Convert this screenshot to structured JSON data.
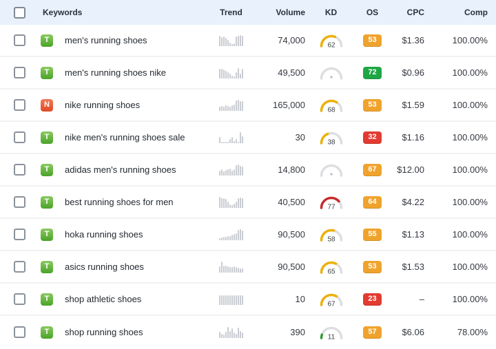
{
  "header": {
    "keywords": "Keywords",
    "trend": "Trend",
    "volume": "Volume",
    "kd": "KD",
    "os": "OS",
    "cpc": "CPC",
    "comp": "Comp"
  },
  "colors": {
    "header_bg": "#e9f1fc",
    "gauge_track": "#dcdee1",
    "gauge_na_dot": "#b6bac0",
    "spark_bar": "#c9ccd2",
    "kd": {
      "green": "#2f9e33",
      "yellow": "#edb009",
      "red": "#c62b2b",
      "gray": "#dcdee1"
    },
    "os": {
      "green": "#1ea744",
      "amber": "#f0a32c",
      "red": "#e23b31"
    },
    "intent": {
      "green": [
        "#8bc961",
        "#4aa328"
      ],
      "red": [
        "#f07a55",
        "#df4a26"
      ]
    }
  },
  "rows": [
    {
      "intent": "T",
      "intent_style": "green",
      "keyword": "men's running shoes",
      "volume": "74,000",
      "kd": 62,
      "kd_style": "yellow",
      "os": 53,
      "os_style": "amber",
      "cpc": "$1.36",
      "comp": "100.00%",
      "trend": [
        0.95,
        0.8,
        0.85,
        0.75,
        0.55,
        0.3,
        0.2,
        0.25,
        0.9,
        0.95,
        1.0,
        0.95
      ]
    },
    {
      "intent": "T",
      "intent_style": "green",
      "keyword": "men's running shoes nike",
      "volume": "49,500",
      "kd": null,
      "kd_style": "gray",
      "os": 72,
      "os_style": "green",
      "cpc": "$0.96",
      "comp": "100.00%",
      "trend": [
        0.9,
        0.85,
        0.8,
        0.7,
        0.55,
        0.45,
        0.25,
        0.2,
        0.55,
        0.95,
        0.45,
        0.85
      ]
    },
    {
      "intent": "N",
      "intent_style": "red",
      "keyword": "nike running shoes",
      "volume": "165,000",
      "kd": 68,
      "kd_style": "yellow",
      "os": 53,
      "os_style": "amber",
      "cpc": "$1.59",
      "comp": "100.00%",
      "trend": [
        0.35,
        0.45,
        0.4,
        0.5,
        0.45,
        0.4,
        0.5,
        0.55,
        0.95,
        1.0,
        0.9,
        0.85
      ]
    },
    {
      "intent": "T",
      "intent_style": "green",
      "keyword": "nike men's running shoes sale",
      "volume": "30",
      "kd": 38,
      "kd_style": "yellow",
      "os": 32,
      "os_style": "red",
      "cpc": "$1.16",
      "comp": "100.00%",
      "trend": [
        0.55,
        0.15,
        0.1,
        0.12,
        0.1,
        0.35,
        0.55,
        0.2,
        0.35,
        0.15,
        1.0,
        0.6
      ]
    },
    {
      "intent": "T",
      "intent_style": "green",
      "keyword": "adidas men's running shoes",
      "volume": "14,800",
      "kd": null,
      "kd_style": "gray",
      "os": 67,
      "os_style": "amber",
      "cpc": "$12.00",
      "comp": "100.00%",
      "trend": [
        0.45,
        0.55,
        0.35,
        0.5,
        0.55,
        0.65,
        0.45,
        0.55,
        0.95,
        1.0,
        0.9,
        0.8
      ]
    },
    {
      "intent": "T",
      "intent_style": "green",
      "keyword": "best running shoes for men",
      "volume": "40,500",
      "kd": 77,
      "kd_style": "red",
      "os": 64,
      "os_style": "amber",
      "cpc": "$4.22",
      "comp": "100.00%",
      "trend": [
        1.0,
        0.9,
        0.85,
        0.8,
        0.55,
        0.3,
        0.25,
        0.35,
        0.55,
        0.85,
        0.95,
        0.9
      ]
    },
    {
      "intent": "T",
      "intent_style": "green",
      "keyword": "hoka running shoes",
      "volume": "90,500",
      "kd": 58,
      "kd_style": "yellow",
      "os": 55,
      "os_style": "amber",
      "cpc": "$1.13",
      "comp": "100.00%",
      "trend": [
        0.2,
        0.25,
        0.3,
        0.3,
        0.35,
        0.4,
        0.5,
        0.55,
        0.65,
        0.95,
        1.0,
        0.9
      ]
    },
    {
      "intent": "T",
      "intent_style": "green",
      "keyword": "asics running shoes",
      "volume": "90,500",
      "kd": 65,
      "kd_style": "yellow",
      "os": 53,
      "os_style": "amber",
      "cpc": "$1.53",
      "comp": "100.00%",
      "trend": [
        0.55,
        1.0,
        0.65,
        0.6,
        0.55,
        0.5,
        0.5,
        0.55,
        0.5,
        0.45,
        0.4,
        0.35
      ]
    },
    {
      "intent": "T",
      "intent_style": "green",
      "keyword": "shop athletic shoes",
      "volume": "10",
      "kd": 67,
      "kd_style": "yellow",
      "os": 23,
      "os_style": "red",
      "cpc": "–",
      "comp": "100.00%",
      "trend": [
        0.85,
        0.85,
        0.85,
        0.85,
        0.85,
        0.85,
        0.85,
        0.85,
        0.85,
        0.85,
        0.85,
        0.85
      ]
    },
    {
      "intent": "T",
      "intent_style": "green",
      "keyword": "shop running shoes",
      "volume": "390",
      "kd": 11,
      "kd_style": "green",
      "os": 57,
      "os_style": "amber",
      "cpc": "$6.06",
      "comp": "78.00%",
      "trend": [
        0.55,
        0.4,
        0.3,
        0.55,
        1.0,
        0.65,
        0.9,
        0.5,
        0.4,
        0.95,
        0.6,
        0.5
      ]
    }
  ]
}
